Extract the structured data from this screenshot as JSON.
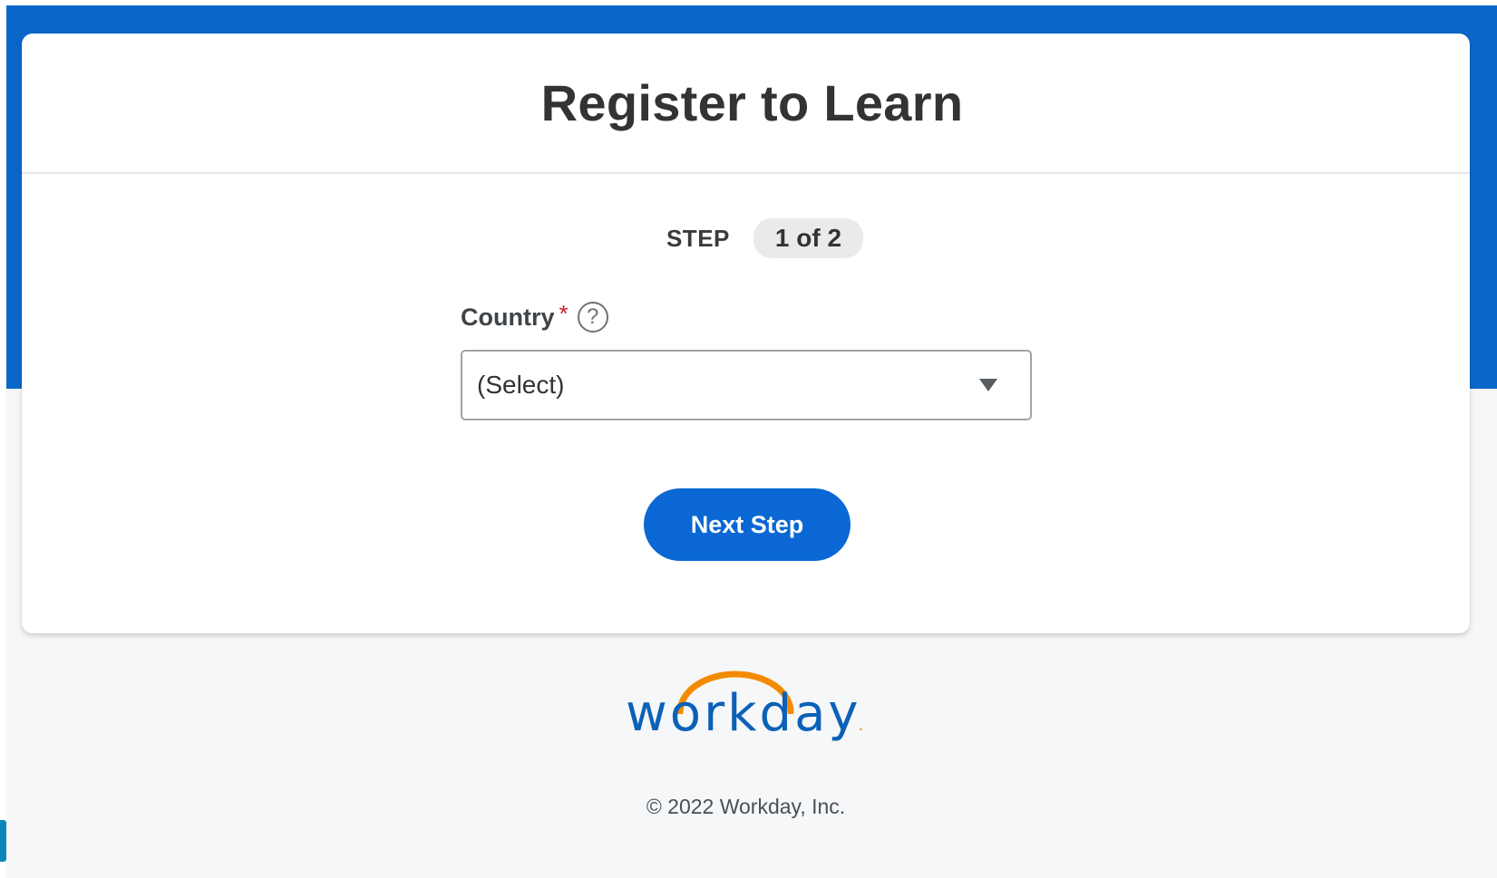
{
  "page": {
    "title": "Register to Learn"
  },
  "step": {
    "label": "STEP",
    "indicator": "1 of 2"
  },
  "form": {
    "country_label": "Country",
    "required_marker": "*",
    "help_glyph": "?",
    "country_value": "(Select)"
  },
  "actions": {
    "next_label": "Next Step"
  },
  "footer": {
    "logo_text": "workday",
    "logo_dot": ".",
    "copyright": "© 2022 Workday, Inc."
  },
  "colors": {
    "brand_blue": "#0a67c9",
    "button_blue": "#0a67d4",
    "logo_blue": "#0b61b8",
    "logo_orange": "#f38b00",
    "required_red": "#cc2229"
  },
  "icons": {
    "help": "help-icon",
    "dropdown": "chevron-down-icon"
  }
}
